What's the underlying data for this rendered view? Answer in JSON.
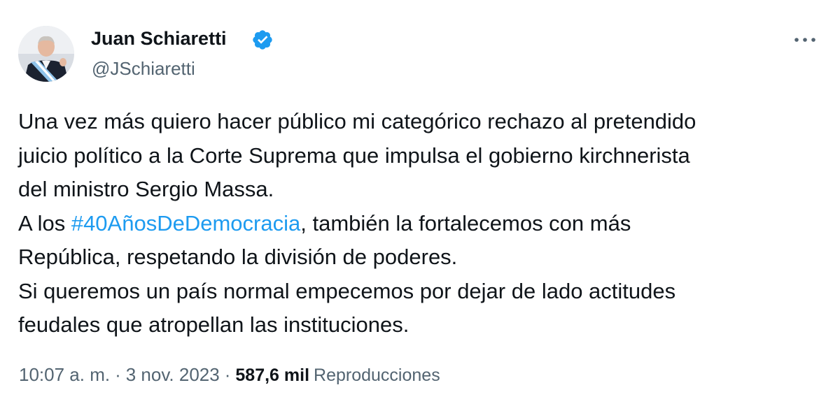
{
  "author": {
    "name": "Juan Schiaretti",
    "handle": "@JSchiaretti",
    "verified": true
  },
  "tweet": {
    "line1": "Una vez más quiero hacer público mi categórico rechazo al pretendido",
    "line2": "juicio político a la Corte Suprema que impulsa el gobierno kirchnerista",
    "line3": "del ministro Sergio Massa.",
    "line4_prefix": "A los ",
    "hashtag": "#40AñosDeDemocracia",
    "line4_suffix": ", también la fortalecemos con más",
    "line5": "República, respetando la división de poderes.",
    "line6": "Si queremos un país normal empecemos por dejar de lado actitudes",
    "line7": "feudales que atropellan las instituciones."
  },
  "meta": {
    "time": "10:07 a. m.",
    "separator": "·",
    "date": "3 nov. 2023",
    "views_count": "587,6 mil",
    "views_label": "Reproducciones"
  },
  "colors": {
    "text": "#0f1419",
    "secondary": "#536471",
    "link": "#1d9bf0",
    "verified": "#1d9bf0"
  },
  "icons": {
    "verified": "verified-badge-icon",
    "more": "more-horizontal-icon"
  }
}
